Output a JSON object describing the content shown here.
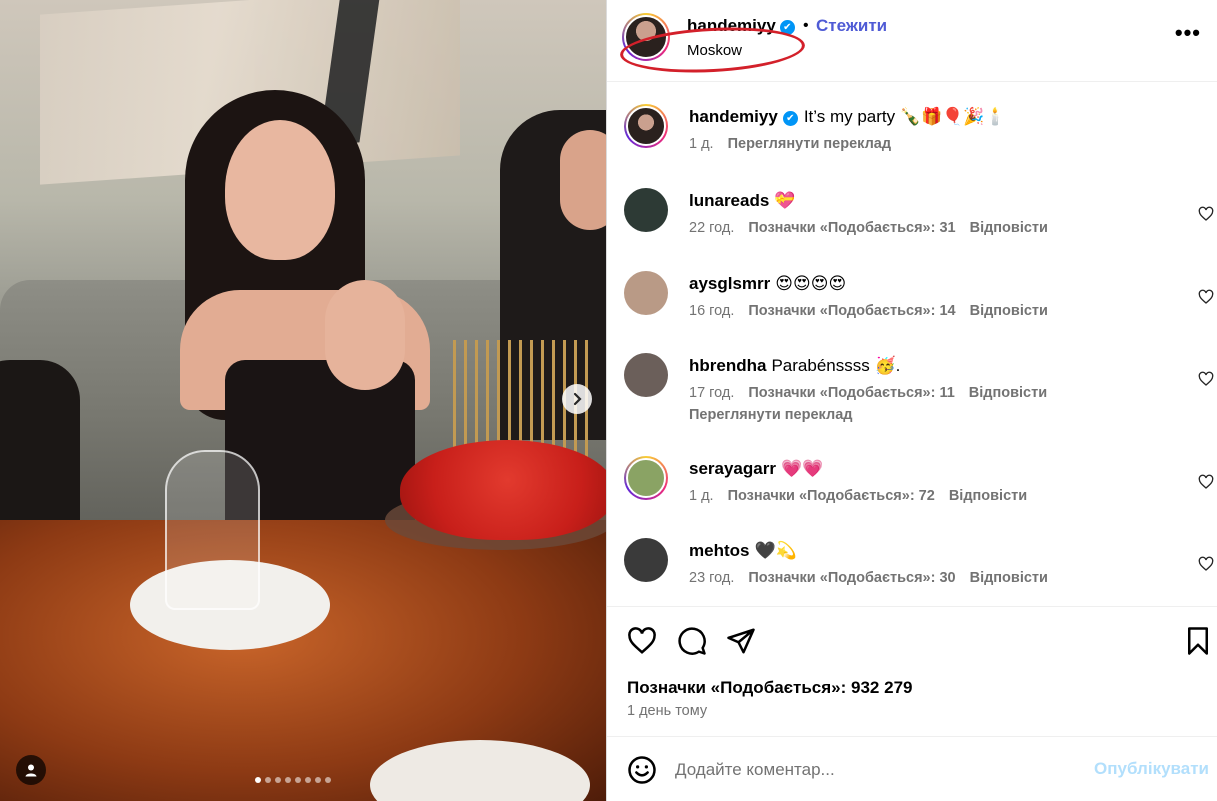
{
  "post": {
    "carousel_count": 8,
    "carousel_active": 1
  },
  "header": {
    "username": "handemiyy",
    "verified_icon": "✔",
    "separator": "•",
    "follow_label": "Стежити",
    "location": "Moskow",
    "more_label": "•••"
  },
  "caption": {
    "username": "handemiyy",
    "text": "It’s my party 🍾🎁🎈🎉🕯️",
    "time": "1 д.",
    "translate": "Переглянути переклад"
  },
  "comments": [
    {
      "username": "lunareads",
      "text": "💝",
      "time": "22 год.",
      "likes": "Позначки «Подобається»: 31",
      "reply": "Відповісти",
      "avatar_color": "#2d3a35"
    },
    {
      "username": "aysglsmrr",
      "text": "😍😍😍😍",
      "time": "16 год.",
      "likes": "Позначки «Подобається»: 14",
      "reply": "Відповісти",
      "avatar_color": "#b99a86"
    },
    {
      "username": "hbrendha",
      "text": "Parabénssss 🥳.",
      "time": "17 год.",
      "likes": "Позначки «Подобається»: 11",
      "reply": "Відповісти",
      "translate": "Переглянути переклад",
      "avatar_color": "#6b5f5a"
    },
    {
      "username": "serayagarr",
      "text": "💗💗",
      "time": "1 д.",
      "likes": "Позначки «Подобається»: 72",
      "reply": "Відповісти",
      "avatar_color": "#8aa364"
    },
    {
      "username": "mehtos",
      "text": "🖤💫",
      "time": "23 год.",
      "likes": "Позначки «Подобається»: 30",
      "reply": "Відповісти",
      "avatar_color": "#3a3a3a"
    }
  ],
  "footer": {
    "likes": "Позначки «Подобається»: 932 279",
    "time": "1 день тому"
  },
  "compose": {
    "placeholder": "Додайте коментар...",
    "publish_label": "Опублікувати"
  },
  "icons": {
    "like": "heart-icon",
    "comment": "comment-icon",
    "share": "share-icon",
    "save": "bookmark-icon",
    "emoji": "emoji-icon",
    "next": "chevron-right-icon",
    "tagged": "user-icon"
  },
  "colors": {
    "follow": "#4f5bd5",
    "verified": "#0095f6",
    "highlight": "#d3202a",
    "publish_disabled": "#b2dffc"
  }
}
